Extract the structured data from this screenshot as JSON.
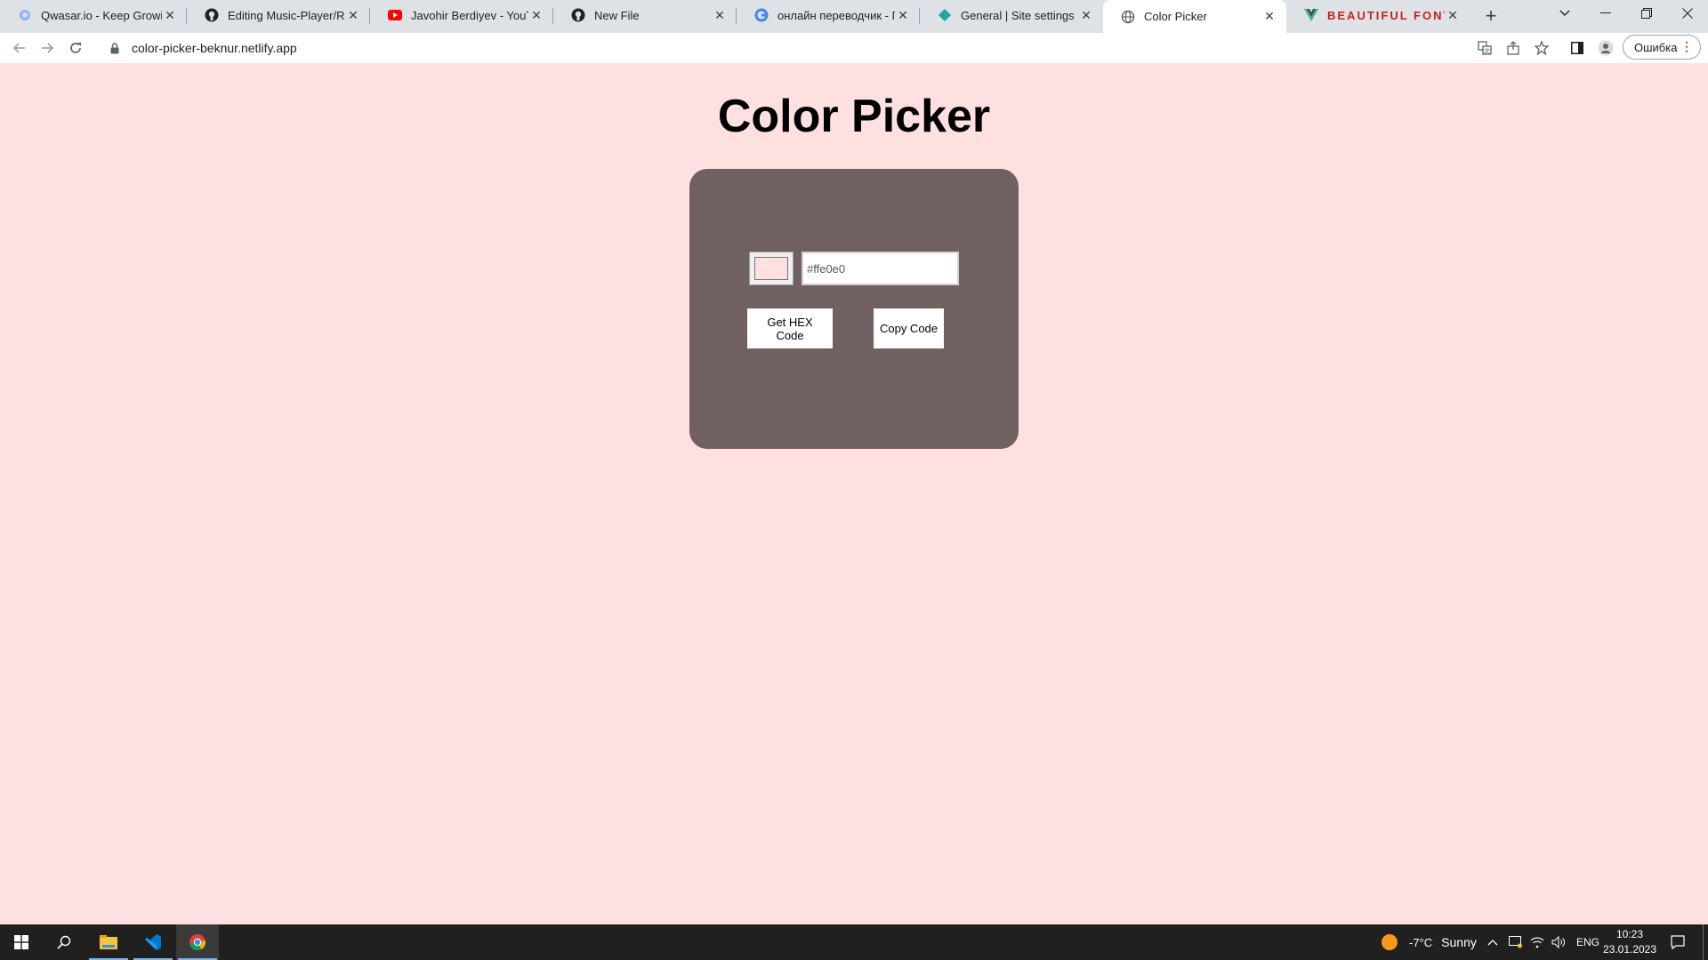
{
  "browser": {
    "tabs": [
      {
        "title": "Qwasar.io - Keep Growing",
        "icon": "qwasar-icon"
      },
      {
        "title": "Editing Music-Player/README",
        "icon": "github-icon"
      },
      {
        "title": "Javohir Berdiyev - YouTube",
        "icon": "youtube-icon"
      },
      {
        "title": "New File",
        "icon": "github-icon"
      },
      {
        "title": "онлайн переводчик - Поиск",
        "icon": "google-icon"
      },
      {
        "title": "General | Site settings",
        "icon": "netlify-icon"
      },
      {
        "title": "Color Picker",
        "icon": "globe-icon",
        "active": true
      },
      {
        "title": "BEAUTIFUL FONTS",
        "icon": "vue-icon"
      }
    ],
    "url": "color-picker-beknur.netlify.app",
    "profile_label": "Ошибка"
  },
  "page": {
    "title": "Color Picker",
    "color_value": "#ffe0e0",
    "hex_text": "#ffe0e0",
    "get_hex_label": "Get HEX Code",
    "copy_label": "Copy Code",
    "colors": {
      "background": "#ffe0e0",
      "card": "#706060"
    }
  },
  "taskbar": {
    "weather_temp": "-7°C",
    "weather_desc": "Sunny",
    "lang": "ENG",
    "time": "10:23",
    "date": "23.01.2023"
  }
}
